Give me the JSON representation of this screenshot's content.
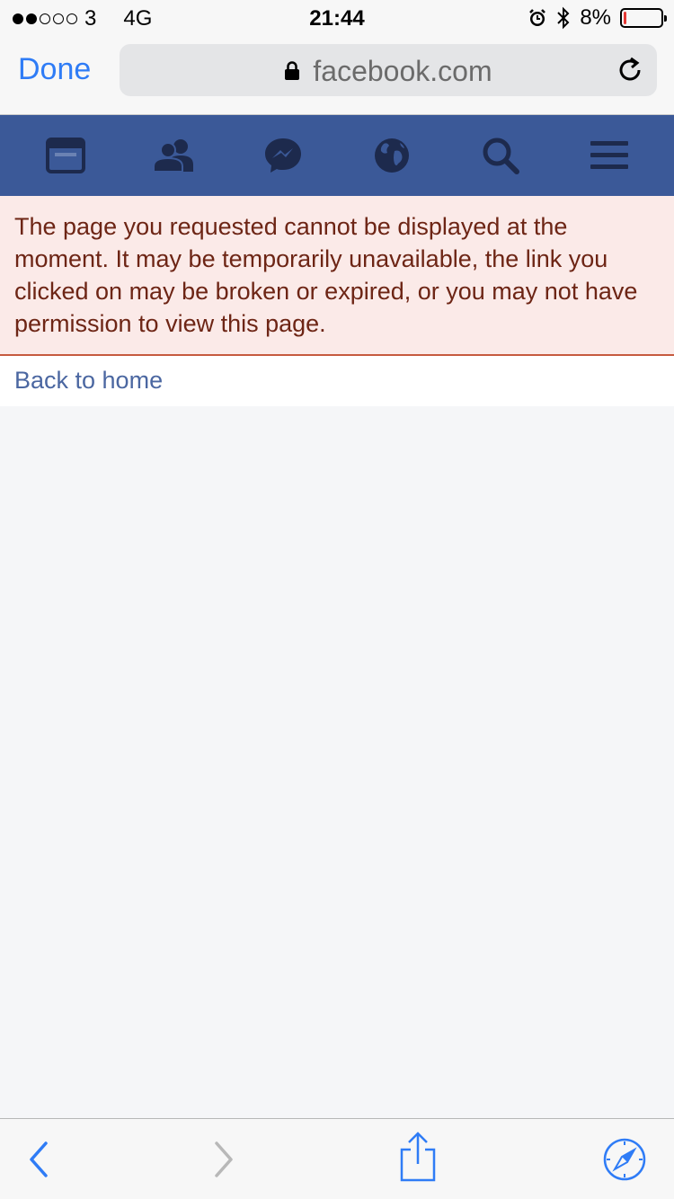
{
  "status_bar": {
    "carrier": "3",
    "network": "4G",
    "time": "21:44",
    "battery": "8%",
    "battery_level": 0.08,
    "signal_bars_filled": 2,
    "signal_bars_total": 5
  },
  "browser": {
    "done_label": "Done",
    "url": "facebook.com",
    "accent_color": "#2f7cf6"
  },
  "fb_nav": {
    "color": "#3b5998",
    "icons": [
      "news-feed-icon",
      "friends-icon",
      "messenger-icon",
      "globe-icon",
      "search-icon",
      "menu-icon"
    ]
  },
  "error": {
    "message": "The page you requested cannot be displayed at the moment. It may be temporarily unavailable, the link you clicked on may be broken or expired, or you may not have permission to view this page."
  },
  "home_link": {
    "label": "Back to home"
  },
  "toolbar": {
    "icons": [
      "back-icon",
      "forward-icon",
      "share-icon",
      "safari-icon"
    ]
  }
}
